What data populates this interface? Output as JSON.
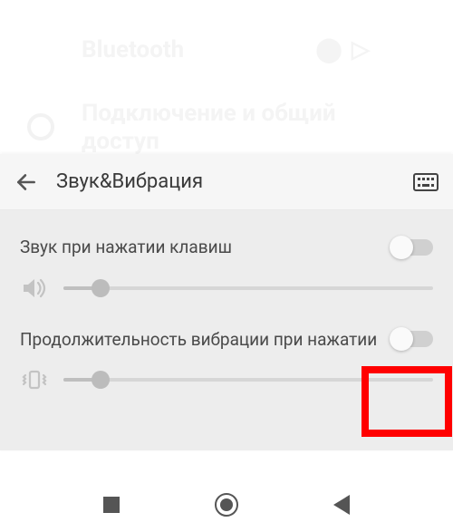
{
  "ghost": {
    "bluetooth": "Bluetooth",
    "toggle_hint": "⬤ ▷",
    "share": "Подключение и общий доступ"
  },
  "appbar": {
    "title": "Звук&Вибрация"
  },
  "settings": {
    "key_sound": {
      "label": "Звук при нажатии клавиш",
      "enabled": false,
      "slider_percent": 10
    },
    "vibration_duration": {
      "label": "Продолжительность вибрации при нажатии",
      "enabled": false,
      "slider_percent": 10
    }
  },
  "highlight": {
    "target": "settings.vibration_duration.enabled"
  }
}
